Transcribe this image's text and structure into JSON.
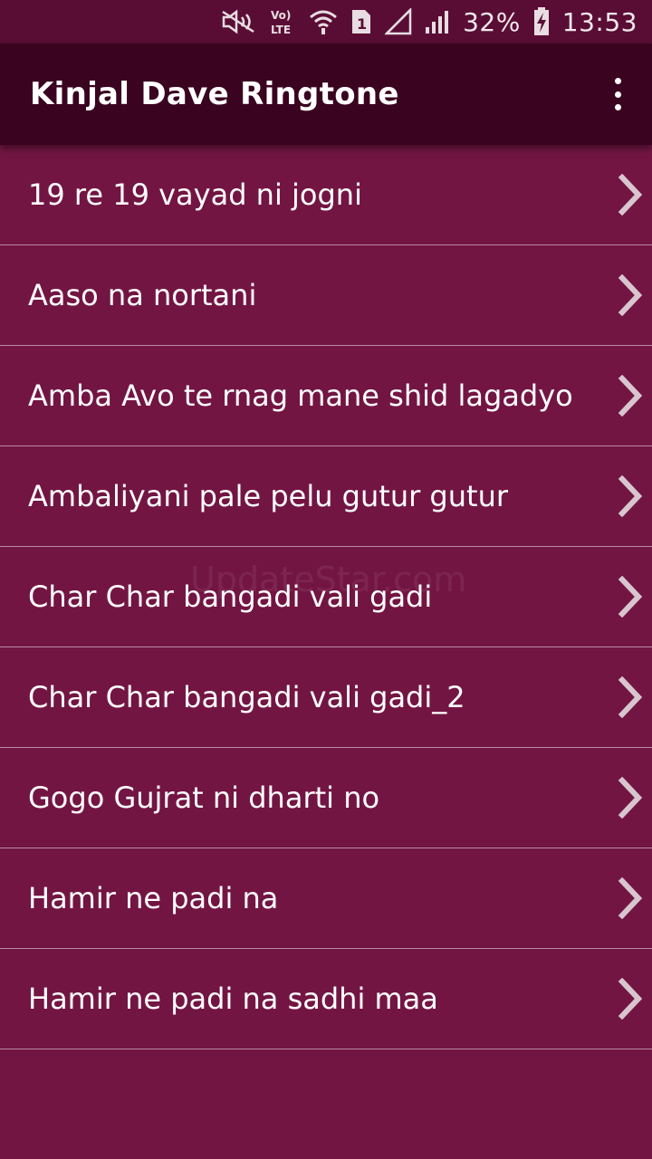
{
  "status_bar": {
    "battery_percent": "32%",
    "time": "13:53",
    "sim_slot": "1",
    "icons": [
      "mute-icon",
      "volte-icon",
      "wifi-icon",
      "sim-1-icon",
      "no-signal-icon",
      "signal-icon",
      "battery-charging-icon"
    ]
  },
  "app_bar": {
    "title": "Kinjal Dave Ringtone",
    "menu_icon": "more-vert-icon"
  },
  "ringtones": [
    {
      "label": "19 re 19 vayad ni jogni"
    },
    {
      "label": "Aaso na nortani"
    },
    {
      "label": "Amba Avo te rnag mane shid lagadyo"
    },
    {
      "label": "Ambaliyani pale pelu gutur gutur"
    },
    {
      "label": "Char Char bangadi vali gadi"
    },
    {
      "label": "Char Char bangadi vali gadi_2"
    },
    {
      "label": "Gogo Gujrat ni dharti no"
    },
    {
      "label": "Hamir ne padi na"
    },
    {
      "label": "Hamir ne padi na sadhi maa"
    }
  ],
  "watermark": "UpdateStar.com",
  "colors": {
    "background": "#731543",
    "app_bar": "#3a0320",
    "status_bar": "#5a0d34",
    "divider": "#b98aa1"
  }
}
